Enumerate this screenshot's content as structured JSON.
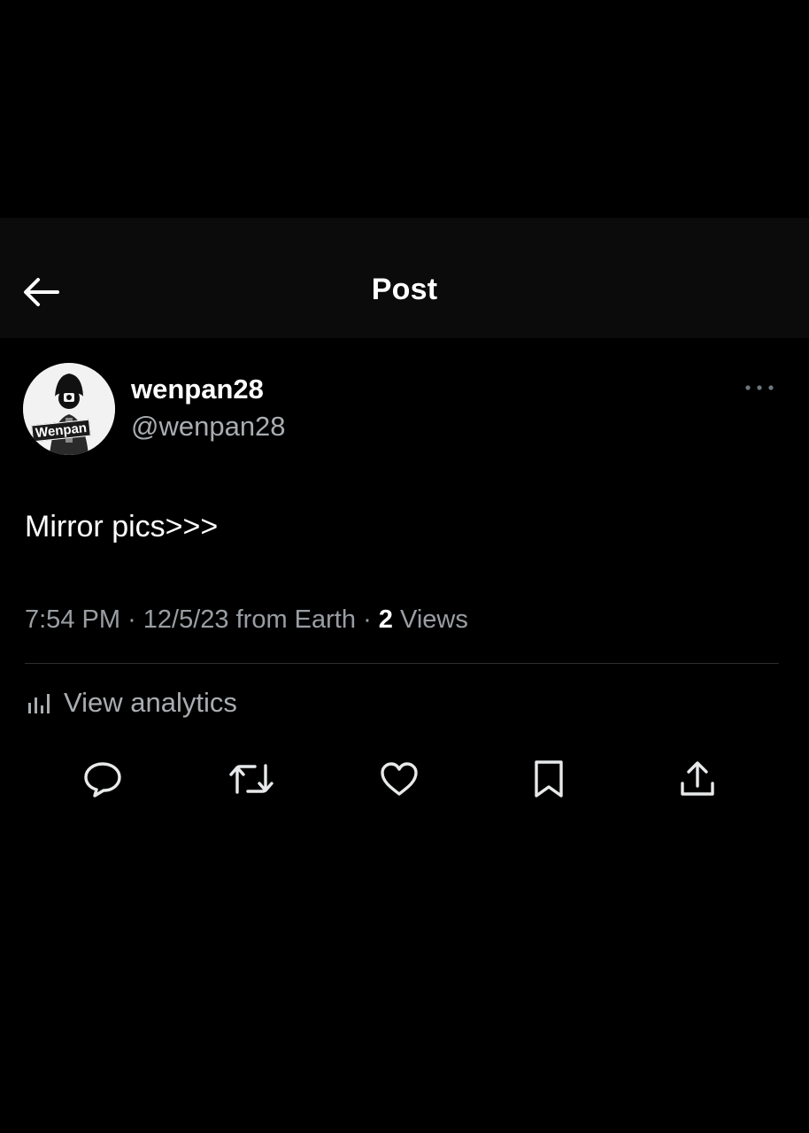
{
  "header": {
    "title": "Post",
    "back_icon": "arrow-left-icon"
  },
  "post": {
    "author": {
      "display_name": "wenpan28",
      "handle": "@wenpan28",
      "avatar_label": "Wenpan"
    },
    "text": "Mirror pics>>>",
    "time": "7:54 PM",
    "date": "12/5/23",
    "source": "from Earth",
    "views_count": "2",
    "views_label": "Views",
    "separator": "·"
  },
  "analytics": {
    "label": "View analytics",
    "icon": "bar-chart-icon"
  },
  "actions": {
    "reply_icon": "reply-icon",
    "repost_icon": "repost-icon",
    "like_icon": "heart-icon",
    "bookmark_icon": "bookmark-icon",
    "share_icon": "share-icon"
  },
  "colors": {
    "background": "#000000",
    "header_background": "#0b0b0b",
    "primary_text": "#ffffff",
    "secondary_text": "#a9adb1",
    "divider": "#2b2e31"
  }
}
